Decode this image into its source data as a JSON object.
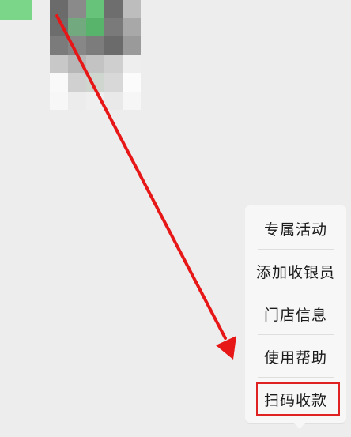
{
  "colors": {
    "background": "#ededed",
    "popup": "#f7f7f7",
    "highlight_border": "#e02121",
    "arrow": "#e81717",
    "top_green_chip": "#7bd68a"
  },
  "menu": {
    "items": [
      {
        "label": "专属活动"
      },
      {
        "label": "添加收银员"
      },
      {
        "label": "门店信息"
      },
      {
        "label": "使用帮助"
      },
      {
        "label": "扫码收款"
      }
    ],
    "highlighted_label": "扫码收款"
  },
  "icons": {
    "annotation_arrow": "red-arrow-icon",
    "mosaic_qr": "qr-code-mosaic-icon"
  },
  "mosaic": {
    "palette": [
      "#8c8c8c",
      "#a0a0a0",
      "#69b978",
      "#6a6a6a",
      "#b5b5b5",
      "#f8f8f8"
    ]
  }
}
